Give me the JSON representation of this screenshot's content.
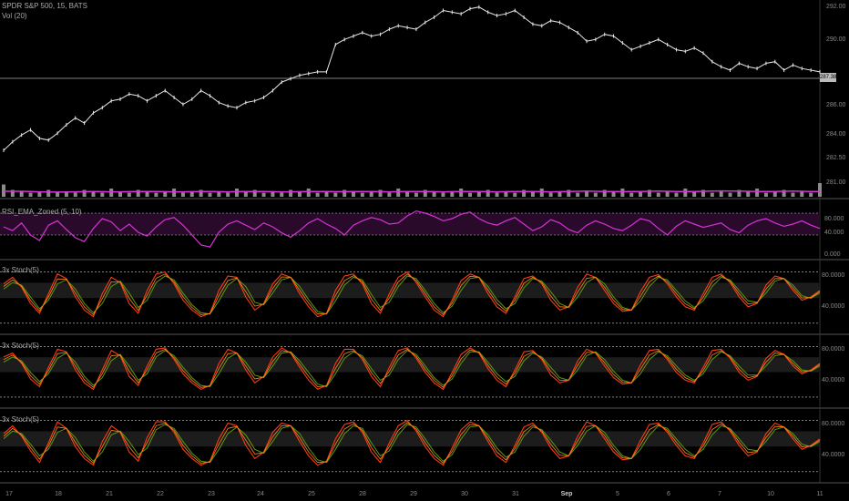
{
  "header": {
    "symbol": "SPDR S&P 500, 15, BATS",
    "volume": "Vol (20)"
  },
  "panes": {
    "rsi_label": "RSI_EMA_Zoned (5, 10)",
    "stoch1_label": "3x Stoch(5)",
    "stoch2_label": "3x Stoch(5)",
    "stoch3_label": "3x Stoch(5)"
  },
  "price_axis": [
    "292.00",
    "290.00",
    "288.00",
    "286.00",
    "284.00",
    "282.50",
    "281.00"
  ],
  "current_price": "287.38",
  "rsi_axis": [
    "80.000",
    "40.000",
    "0.000"
  ],
  "stoch1_axis": [
    "80.0000",
    "40.0000"
  ],
  "stoch2_axis": [
    "80.0000",
    "40.0000"
  ],
  "stoch3_axis": [
    "80.0000",
    "40.0000"
  ],
  "x_axis": [
    "17",
    "18",
    "21",
    "22",
    "23",
    "24",
    "25",
    "28",
    "29",
    "30",
    "31",
    "Sep",
    "5",
    "6",
    "7",
    "10",
    "11"
  ],
  "colors": {
    "price": "#e6e6e6",
    "volume": "#8a8a8a",
    "volume_ma": "#d633d6",
    "rsi": "#d633d6",
    "rsi_zone": "#2a0a2a",
    "stoch_fast": "#ff3b14",
    "stoch_slow": "#5a9a12",
    "stoch_mid": "#ff8c1a",
    "dashed": "#cccccc"
  },
  "chart_data": [
    {
      "type": "line",
      "series": [
        {
          "values": [
            283.4,
            283.9,
            284.3,
            284.6,
            284.1,
            284.0,
            284.4,
            284.9,
            285.3,
            285.0,
            285.6,
            285.9,
            286.3,
            286.4,
            286.7,
            286.6,
            286.3,
            286.6,
            286.9,
            286.5,
            286.1,
            286.4,
            286.9,
            286.6,
            286.2,
            286.0,
            285.9,
            286.2,
            286.3,
            286.5,
            286.9,
            287.4,
            287.6,
            287.8,
            287.9,
            288.0,
            288.0,
            289.6,
            289.9,
            290.1,
            290.3,
            290.1,
            290.2,
            290.5,
            290.7,
            290.6,
            290.5,
            290.9,
            291.2,
            291.6,
            291.5,
            291.4,
            291.7,
            291.8,
            291.5,
            291.3,
            291.4,
            291.6,
            291.2,
            290.8,
            290.7,
            291.0,
            290.9,
            290.6,
            290.3,
            289.8,
            289.9,
            290.2,
            290.1,
            289.7,
            289.3,
            289.5,
            289.7,
            289.9,
            289.6,
            289.3,
            289.2,
            289.4,
            289.1,
            288.6,
            288.3,
            288.1,
            288.5,
            288.3,
            288.2,
            288.5,
            288.6,
            288.1,
            288.4,
            288.2,
            288.1,
            288.0
          ]
        }
      ],
      "ylim": [
        281,
        292
      ]
    },
    {
      "type": "bar",
      "series": [
        {
          "values": [
            9,
            5,
            4,
            3,
            4,
            5,
            3,
            4,
            3,
            5,
            4,
            3,
            6,
            4,
            3,
            5,
            4,
            3,
            4,
            6,
            3,
            4,
            5,
            3,
            4,
            3,
            6,
            4,
            5,
            3,
            4,
            3,
            5,
            4,
            6,
            3,
            4,
            3,
            5,
            4,
            3,
            4,
            5,
            3,
            6,
            4,
            3,
            5,
            4,
            3,
            4,
            6,
            3,
            4,
            5,
            3,
            4,
            3,
            5,
            4,
            6,
            3,
            4,
            5,
            3,
            4,
            3,
            5,
            4,
            6,
            3,
            4,
            5,
            3,
            4,
            3,
            6,
            4,
            5,
            3,
            4,
            3,
            5,
            4,
            6,
            3,
            4,
            5,
            3,
            4,
            3,
            10
          ]
        },
        {
          "values": [
            4,
            4,
            4,
            3.8,
            3.6,
            3.5,
            3.4,
            3.5,
            3.6,
            3.7,
            3.8,
            3.7,
            3.6,
            3.6,
            3.7,
            3.8,
            3.9,
            3.8,
            3.7,
            3.6,
            3.6,
            3.7,
            3.8,
            3.8,
            3.7,
            3.6,
            3.7,
            3.8,
            3.9,
            3.8,
            3.7,
            3.6,
            3.6,
            3.7,
            3.8,
            3.9,
            3.8,
            3.7,
            3.7,
            3.8,
            3.9,
            3.8,
            3.7,
            3.6,
            3.7,
            3.8,
            3.9,
            3.8,
            3.7,
            3.6,
            3.7,
            3.8,
            3.9,
            3.8,
            3.7,
            3.6,
            3.7,
            3.8,
            3.9,
            3.8,
            3.7,
            3.6,
            3.7,
            3.8,
            4.0,
            4.1,
            4.0,
            3.9,
            3.8,
            3.7,
            3.8,
            3.9,
            4.0,
            4.1,
            4.0,
            3.9,
            3.8,
            3.9,
            4.0,
            4.2,
            4.3,
            4.2,
            4.1,
            4.0,
            3.9,
            3.8,
            3.9,
            4.0,
            4.1,
            4.0,
            3.9,
            3.9
          ]
        }
      ]
    },
    {
      "type": "line",
      "series": [
        {
          "values": [
            55,
            48,
            62,
            40,
            30,
            58,
            66,
            50,
            35,
            28,
            52,
            70,
            64,
            48,
            60,
            45,
            38,
            55,
            68,
            72,
            58,
            40,
            22,
            18,
            45,
            60,
            66,
            58,
            50,
            62,
            55,
            44,
            36,
            48,
            62,
            70,
            60,
            52,
            40,
            58,
            66,
            72,
            68,
            60,
            62,
            75,
            84,
            80,
            74,
            66,
            70,
            78,
            82,
            70,
            62,
            58,
            66,
            72,
            60,
            48,
            55,
            68,
            62,
            50,
            44,
            58,
            66,
            60,
            52,
            48,
            58,
            70,
            66,
            52,
            40,
            56,
            66,
            60,
            54,
            58,
            62,
            50,
            44,
            58,
            66,
            70,
            62,
            56,
            60,
            66,
            58,
            52
          ]
        }
      ],
      "ylim": [
        0,
        100
      ]
    },
    {
      "type": "line",
      "series": [
        {
          "values": [
            70,
            80,
            65,
            40,
            25,
            55,
            85,
            78,
            50,
            30,
            20,
            55,
            80,
            72,
            40,
            25,
            60,
            85,
            88,
            70,
            45,
            30,
            20,
            25,
            60,
            82,
            80,
            50,
            30,
            40,
            70,
            85,
            80,
            55,
            35,
            20,
            25,
            60,
            82,
            85,
            70,
            40,
            25,
            55,
            80,
            88,
            72,
            50,
            30,
            20,
            45,
            75,
            85,
            80,
            55,
            35,
            25,
            50,
            78,
            82,
            70,
            45,
            30,
            35,
            65,
            85,
            80,
            60,
            40,
            28,
            30,
            58,
            80,
            84,
            70,
            50,
            35,
            30,
            55,
            80,
            85,
            72,
            50,
            35,
            40,
            68,
            82,
            78,
            60,
            45,
            50,
            60
          ]
        },
        {
          "values": [
            62,
            72,
            68,
            50,
            32,
            45,
            70,
            76,
            62,
            40,
            26,
            40,
            66,
            74,
            56,
            34,
            45,
            72,
            82,
            76,
            56,
            38,
            26,
            24,
            44,
            68,
            78,
            66,
            42,
            38,
            56,
            76,
            80,
            66,
            46,
            28,
            24,
            44,
            68,
            80,
            76,
            54,
            34,
            42,
            66,
            82,
            78,
            60,
            40,
            26,
            36,
            60,
            78,
            80,
            66,
            46,
            32,
            40,
            64,
            78,
            74,
            58,
            40,
            34,
            50,
            72,
            80,
            70,
            50,
            34,
            30,
            44,
            66,
            80,
            76,
            60,
            44,
            34,
            44,
            66,
            80,
            76,
            60,
            44,
            42,
            56,
            74,
            78,
            68,
            52,
            48,
            56
          ]
        }
      ],
      "ylim": [
        0,
        100
      ]
    },
    {
      "type": "line",
      "series": [
        {
          "values": [
            72,
            78,
            62,
            38,
            26,
            56,
            84,
            80,
            52,
            32,
            22,
            52,
            82,
            74,
            42,
            28,
            58,
            84,
            86,
            68,
            46,
            32,
            22,
            28,
            62,
            84,
            78,
            52,
            32,
            42,
            72,
            86,
            78,
            56,
            36,
            22,
            28,
            62,
            84,
            84,
            68,
            42,
            26,
            56,
            82,
            86,
            70,
            48,
            32,
            22,
            48,
            76,
            86,
            78,
            54,
            36,
            26,
            52,
            80,
            82,
            68,
            44,
            32,
            36,
            66,
            84,
            78,
            58,
            40,
            30,
            32,
            60,
            82,
            84,
            68,
            48,
            36,
            32,
            56,
            82,
            84,
            70,
            48,
            36,
            42,
            70,
            82,
            76,
            58,
            46,
            52,
            62
          ]
        },
        {
          "values": [
            64,
            72,
            66,
            48,
            34,
            46,
            70,
            78,
            64,
            42,
            28,
            40,
            66,
            76,
            58,
            36,
            46,
            72,
            82,
            74,
            56,
            40,
            28,
            26,
            46,
            70,
            78,
            64,
            44,
            40,
            58,
            78,
            80,
            66,
            48,
            30,
            26,
            46,
            70,
            80,
            74,
            54,
            36,
            44,
            68,
            82,
            76,
            58,
            40,
            28,
            38,
            62,
            80,
            80,
            64,
            46,
            34,
            42,
            66,
            78,
            72,
            56,
            40,
            36,
            52,
            74,
            80,
            68,
            50,
            36,
            32,
            46,
            68,
            80,
            74,
            58,
            44,
            36,
            46,
            68,
            80,
            74,
            58,
            44,
            44,
            58,
            74,
            76,
            66,
            52,
            50,
            58
          ]
        }
      ],
      "ylim": [
        0,
        100
      ]
    },
    {
      "type": "line",
      "series": [
        {
          "values": [
            68,
            80,
            64,
            42,
            24,
            54,
            86,
            76,
            48,
            30,
            20,
            56,
            80,
            70,
            40,
            26,
            62,
            86,
            86,
            70,
            44,
            30,
            20,
            26,
            60,
            84,
            80,
            50,
            30,
            40,
            70,
            84,
            80,
            56,
            34,
            20,
            26,
            60,
            82,
            86,
            70,
            40,
            24,
            54,
            80,
            88,
            72,
            48,
            30,
            20,
            46,
            74,
            86,
            80,
            56,
            34,
            24,
            50,
            78,
            84,
            70,
            46,
            30,
            34,
            64,
            86,
            80,
            60,
            40,
            28,
            30,
            58,
            82,
            84,
            70,
            50,
            34,
            30,
            54,
            82,
            86,
            72,
            50,
            34,
            40,
            68,
            84,
            78,
            60,
            44,
            50,
            60
          ]
        },
        {
          "values": [
            60,
            72,
            68,
            52,
            34,
            44,
            70,
            76,
            62,
            40,
            26,
            40,
            66,
            72,
            56,
            36,
            46,
            74,
            82,
            76,
            56,
            38,
            26,
            24,
            44,
            68,
            78,
            66,
            44,
            38,
            56,
            76,
            80,
            68,
            46,
            28,
            24,
            44,
            68,
            80,
            76,
            54,
            34,
            42,
            66,
            82,
            78,
            60,
            40,
            26,
            36,
            60,
            78,
            80,
            66,
            46,
            32,
            40,
            64,
            78,
            74,
            58,
            40,
            34,
            50,
            72,
            80,
            70,
            50,
            34,
            30,
            44,
            66,
            80,
            76,
            60,
            44,
            34,
            44,
            66,
            80,
            76,
            60,
            44,
            42,
            56,
            74,
            78,
            68,
            52,
            48,
            56
          ]
        }
      ],
      "ylim": [
        0,
        100
      ]
    }
  ]
}
